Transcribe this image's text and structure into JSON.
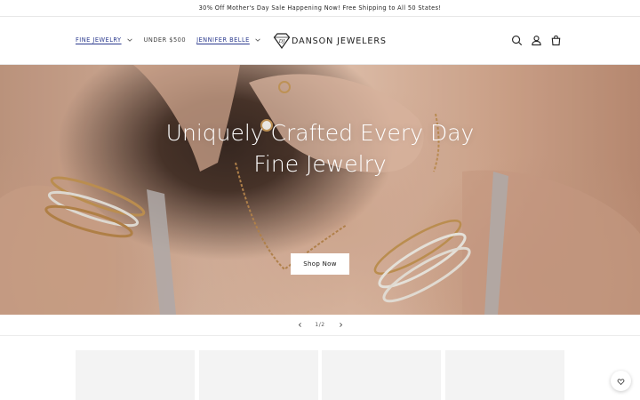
{
  "announcement": {
    "text": "30% Off Mother's Day Sale Happening Now! Free Shipping to All 50 States!"
  },
  "nav": {
    "items": [
      {
        "label": "FINE JEWELRY",
        "has_dropdown": true
      },
      {
        "label": "UNDER $500",
        "has_dropdown": false
      },
      {
        "label": "JENNIFER BELLE",
        "has_dropdown": true
      }
    ]
  },
  "brand": {
    "name": "DANSON JEWELERS",
    "logo_icon": "diamond-monogram-icon"
  },
  "header_icons": [
    "search-icon",
    "account-icon",
    "cart-icon"
  ],
  "hero": {
    "title": "Uniquely Crafted Every Day Fine Jewelry",
    "button_label": "Shop Now"
  },
  "slider": {
    "counter": "1/2",
    "current": 1,
    "total": 2
  },
  "colors": {
    "link": "#2b3a8e",
    "card": "#f3f3f3",
    "text": "#121212"
  }
}
